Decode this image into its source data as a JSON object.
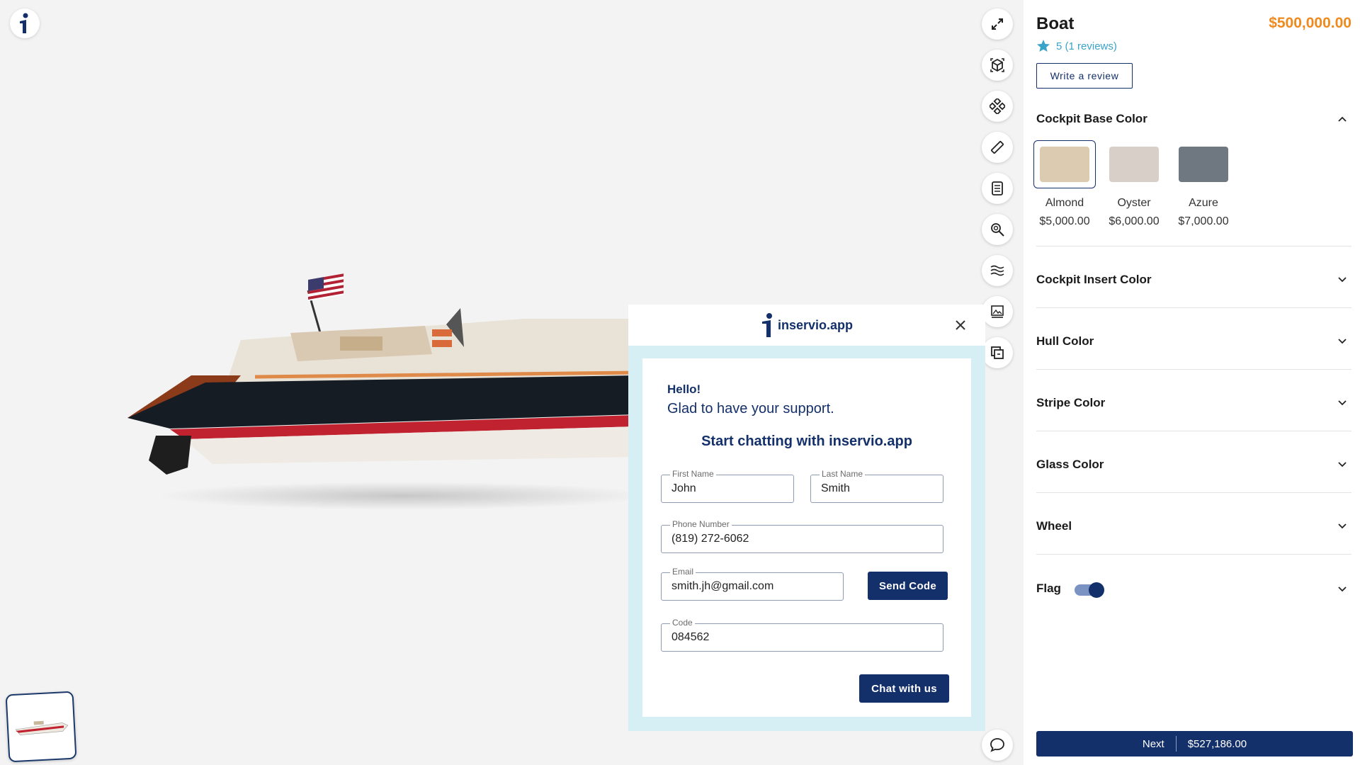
{
  "colors": {
    "navy": "#14306b",
    "orange": "#ef8a1f",
    "teal": "#3aa3c9",
    "modal_bg": "#d6eff5"
  },
  "viewer": {
    "tools": [
      {
        "name": "fullscreen-icon"
      },
      {
        "name": "ar-cube-icon"
      },
      {
        "name": "hotspots-icon"
      },
      {
        "name": "measure-icon"
      },
      {
        "name": "notes-icon"
      },
      {
        "name": "zoom-search-icon"
      },
      {
        "name": "water-icon"
      },
      {
        "name": "gallery-icon"
      },
      {
        "name": "copy-icon"
      }
    ]
  },
  "chat": {
    "brand": "inservio.app",
    "hello": "Hello!",
    "glad": "Glad to have your support.",
    "start": "Start chatting with inservio.app",
    "first_name": {
      "label": "First Name",
      "value": "John"
    },
    "last_name": {
      "label": "Last Name",
      "value": "Smith"
    },
    "phone": {
      "label": "Phone Number",
      "value": "(819) 272-6062"
    },
    "email": {
      "label": "Email",
      "value": "smith.jh@gmail.com"
    },
    "code": {
      "label": "Code",
      "value": "084562"
    },
    "send_code": "Send Code",
    "chat_with_us": "Chat with us"
  },
  "product": {
    "title": "Boat",
    "price": "$500,000.00",
    "rating": "5",
    "reviews": "(1 reviews)",
    "write_review": "Write a review",
    "sections": [
      {
        "title": "Cockpit Base Color"
      },
      {
        "title": "Cockpit Insert Color"
      },
      {
        "title": "Hull Color"
      },
      {
        "title": "Stripe Color"
      },
      {
        "title": "Glass Color"
      },
      {
        "title": "Wheel"
      },
      {
        "title": "Flag"
      }
    ],
    "swatches": [
      {
        "name": "Almond",
        "price": "$5,000.00",
        "color": "#dccbb0",
        "selected": true
      },
      {
        "name": "Oyster",
        "price": "$6,000.00",
        "color": "#d7cfc8",
        "selected": false
      },
      {
        "name": "Azure",
        "price": "$7,000.00",
        "color": "#6f7880",
        "selected": false
      }
    ],
    "flag_enabled": true,
    "next": "Next",
    "total": "$527,186.00"
  }
}
